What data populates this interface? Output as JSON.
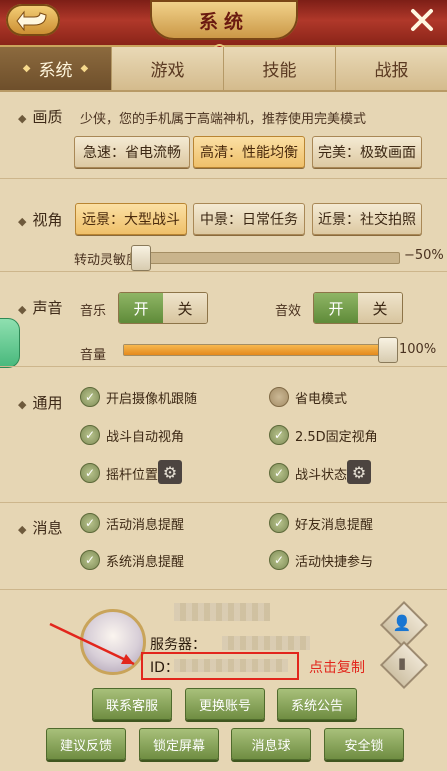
{
  "window": {
    "title": "系统"
  },
  "tabs": [
    {
      "label": "系统",
      "active": true
    },
    {
      "label": "游戏",
      "active": false
    },
    {
      "label": "技能",
      "active": false
    },
    {
      "label": "战报",
      "active": false
    }
  ],
  "quality": {
    "label": "画质",
    "hint": "少侠，您的手机属于高端神机，推荐使用完美模式",
    "options": [
      {
        "label": "急速：省电流畅",
        "selected": false
      },
      {
        "label": "高清：性能均衡",
        "selected": true
      },
      {
        "label": "完美：极致画面",
        "selected": false
      }
    ]
  },
  "view": {
    "label": "视角",
    "options": [
      {
        "label": "远景：大型战斗",
        "selected": true
      },
      {
        "label": "中景：日常任务",
        "selected": false
      },
      {
        "label": "近景：社交拍照",
        "selected": false
      }
    ],
    "sensitivity_label": "转动灵敏度",
    "sensitivity_value_text": "−50%",
    "sensitivity_fraction": 0.0
  },
  "sound": {
    "label": "声音",
    "music_label": "音乐",
    "sfx_label": "音效",
    "on_label": "开",
    "off_label": "关",
    "music_on": true,
    "sfx_on": true,
    "volume_label": "音量",
    "volume_value_text": "100%",
    "volume_fraction": 1.0
  },
  "general": {
    "label": "通用",
    "items": [
      {
        "label": "开启摄像机跟随",
        "checked": true
      },
      {
        "label": "省电模式",
        "checked": false
      },
      {
        "label": "战斗自动视角",
        "checked": true
      },
      {
        "label": "2.5D固定视角",
        "checked": true
      },
      {
        "label": "摇杆位置",
        "checked": true
      },
      {
        "label": "战斗状态",
        "checked": true
      }
    ]
  },
  "messages": {
    "label": "消息",
    "items": [
      {
        "label": "活动消息提醒",
        "checked": true
      },
      {
        "label": "好友消息提醒",
        "checked": true
      },
      {
        "label": "系统消息提醒",
        "checked": true
      },
      {
        "label": "活动快捷参与",
        "checked": true
      }
    ]
  },
  "profile": {
    "server_label": "服务器：",
    "id_label": "ID：",
    "copy_tip": "点击复制"
  },
  "buttons_row1": [
    "联系客服",
    "更换账号",
    "系统公告"
  ],
  "buttons_row2": [
    "建议反馈",
    "锁定屏幕",
    "消息球",
    "安全锁"
  ],
  "icons": {
    "back": "back-arrow-icon",
    "close": "close-icon",
    "gear": "gear-icon",
    "check": "check-icon",
    "user_settings": "user-settings-icon",
    "phone": "phone-icon"
  },
  "colors": {
    "accent": "#efc06a",
    "green": "#6f8d42",
    "highlight": "#e2261c"
  }
}
